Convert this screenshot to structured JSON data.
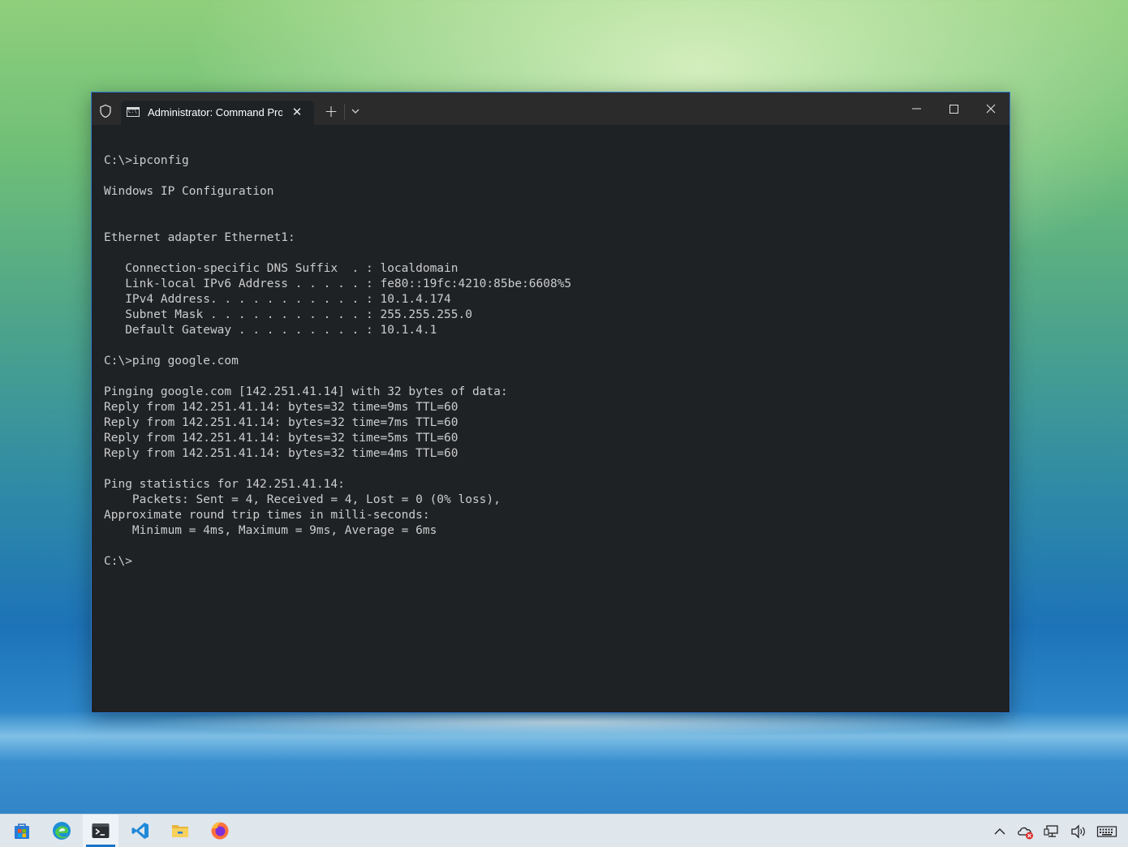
{
  "window": {
    "tab_title": "Administrator: Command Prompt",
    "tab_icon": "cmd-icon",
    "colors": {
      "titlebar": "#2b2b2b",
      "background": "#1f2225",
      "text": "#cccccc",
      "accent": "#2f7ad0"
    }
  },
  "console": {
    "lines": [
      "C:\\>ipconfig",
      "",
      "Windows IP Configuration",
      "",
      "",
      "Ethernet adapter Ethernet1:",
      "",
      "   Connection-specific DNS Suffix  . : localdomain",
      "   Link-local IPv6 Address . . . . . : fe80::19fc:4210:85be:6608%5",
      "   IPv4 Address. . . . . . . . . . . : 10.1.4.174",
      "   Subnet Mask . . . . . . . . . . . : 255.255.255.0",
      "   Default Gateway . . . . . . . . . : 10.1.4.1",
      "",
      "C:\\>ping google.com",
      "",
      "Pinging google.com [142.251.41.14] with 32 bytes of data:",
      "Reply from 142.251.41.14: bytes=32 time=9ms TTL=60",
      "Reply from 142.251.41.14: bytes=32 time=7ms TTL=60",
      "Reply from 142.251.41.14: bytes=32 time=5ms TTL=60",
      "Reply from 142.251.41.14: bytes=32 time=4ms TTL=60",
      "",
      "Ping statistics for 142.251.41.14:",
      "    Packets: Sent = 4, Received = 4, Lost = 0 (0% loss),",
      "Approximate round trip times in milli-seconds:",
      "    Minimum = 4ms, Maximum = 9ms, Average = 6ms",
      "",
      "C:\\>"
    ]
  },
  "taskbar": {
    "apps": [
      "microsoft-store-icon",
      "edge-icon",
      "terminal-icon",
      "vscode-icon",
      "file-explorer-icon",
      "firefox-icon"
    ],
    "active_app": "terminal-icon",
    "tray": [
      "chevron-up-icon",
      "onedrive-error-icon",
      "network-icon",
      "volume-icon",
      "keyboard-icon"
    ]
  }
}
